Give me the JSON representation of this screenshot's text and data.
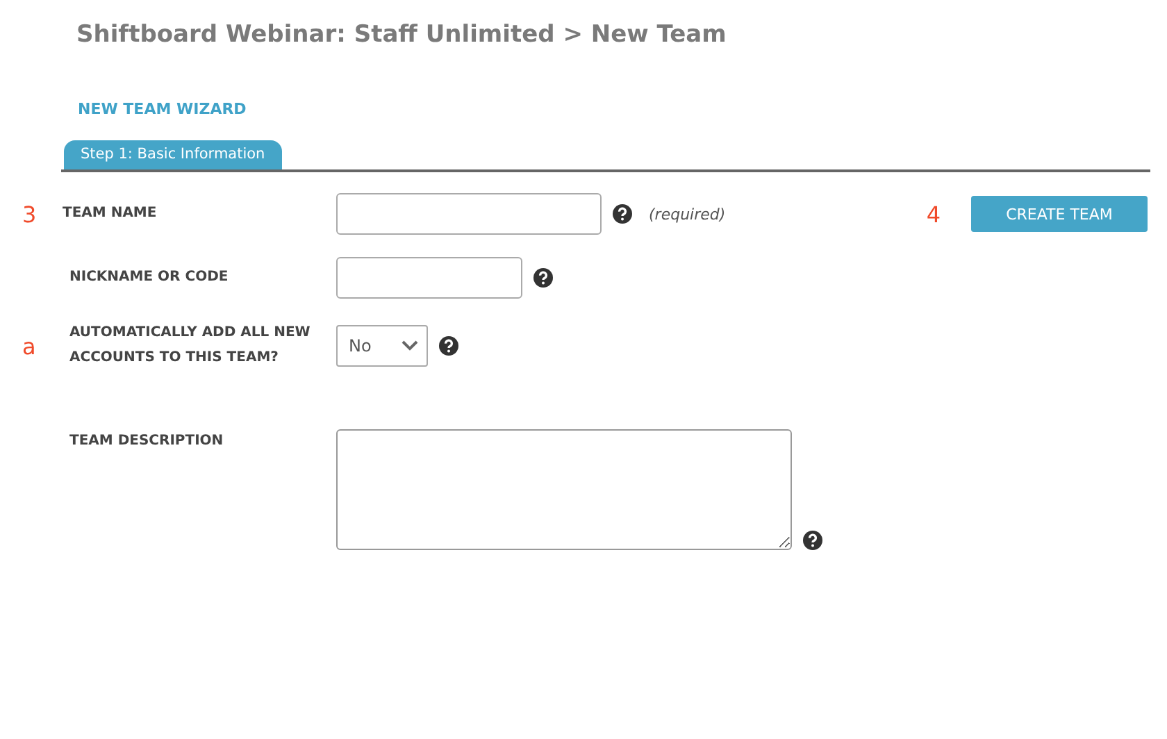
{
  "page_title": "Shiftboard Webinar: Staff Unlimited > New Team",
  "wizard_title": "NEW TEAM WIZARD",
  "tabs": [
    {
      "label": "Step 1: Basic Information",
      "selected": true
    }
  ],
  "fields": [
    {
      "kind": "text",
      "marker": "3",
      "label": "TEAM NAME",
      "note": "(required)"
    },
    {
      "kind": "text",
      "label": "NICKNAME OR CODE"
    },
    {
      "kind": "select",
      "marker": "a",
      "label": "AUTOMATICALLY ADD ALL NEW ACCOUNTS TO THIS TEAM?",
      "value": "No"
    },
    {
      "kind": "textarea",
      "label": "TEAM DESCRIPTION"
    }
  ],
  "create_button": {
    "marker": "4",
    "label": "CREATE TEAM"
  }
}
